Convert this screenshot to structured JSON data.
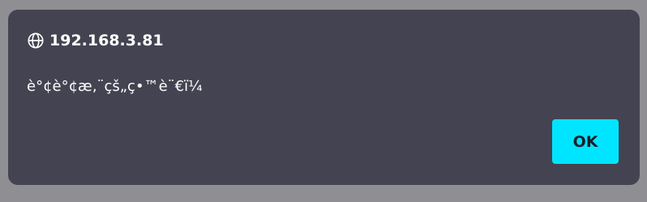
{
  "dialog": {
    "origin": "192.168.3.81",
    "origin_icon": "globe-icon",
    "message": "è°¢è°¢æ‚¨çš„ç•™è¨€ï¼",
    "ok_label": "OK"
  },
  "colors": {
    "backdrop": "#8f8f93",
    "dialog_background": "#444351",
    "text": "#ffffff",
    "accent": "#00e5ff"
  }
}
